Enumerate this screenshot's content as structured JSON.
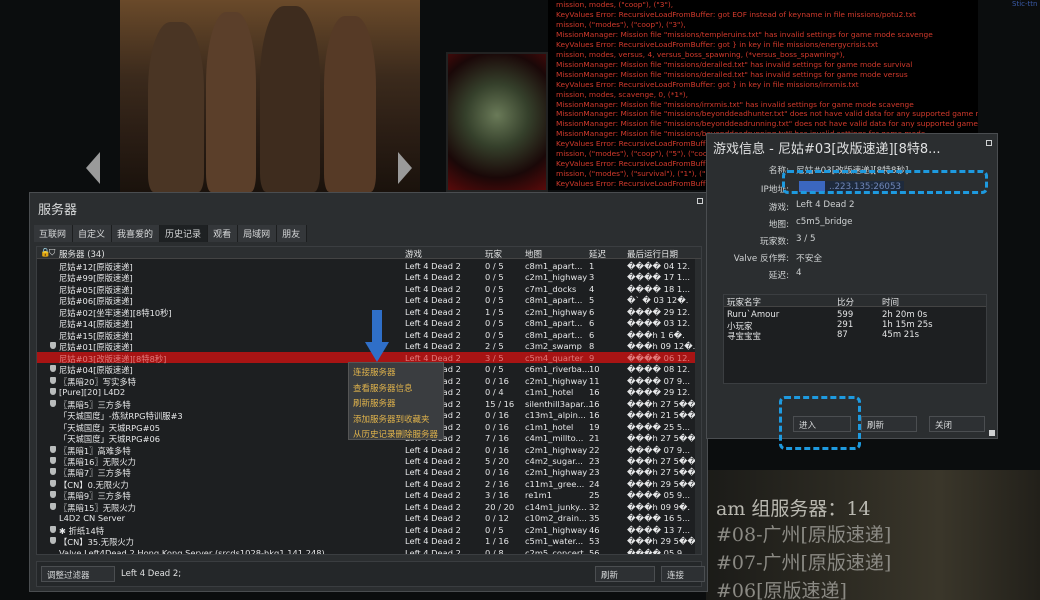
{
  "console": {
    "lines": [
      "mission, modes, (\"coop\"), (\"3\"),",
      "KeyValues Error: RecursiveLoadFromBuffer:  got EOF instead of keyname in file missions/potu2.txt",
      "mission, (\"modes\"), (\"coop\"), (\"3\"),",
      "MissionManager:  Mission file \"missions/templeruins.txt\" has invalid settings for game mode scavenge",
      "KeyValues Error: RecursiveLoadFromBuffer:  got } in key in file missions/energycrisis.txt",
      "mission, modes, versus, 4, versus_boss_spawning, (*versus_boss_spawning*),",
      "MissionManager:  Mission file \"missions/derailed.txt\" has invalid settings for game mode survival",
      "MissionManager:  Mission file \"missions/derailed.txt\" has invalid settings for game mode versus",
      "KeyValues Error: RecursiveLoadFromBuffer:  got } in key in file missions/irrxmis.txt",
      "mission, modes, scavenge, 0, (*1*),",
      "MissionManager:  Mission file \"missions/irrxmis.txt\" has invalid settings for game mode scavenge",
      "MissionManager:  Mission file \"missions/beyonddeadhunter.txt\" does not have valid data for any supported game mode",
      "MissionManager:  Mission file \"missions/beyonddeadrunning.txt\" does not have valid data for any supported game mode",
      "MissionManager:  Mission file \"missions/beyonddeadrunning.txt\" has invalid settings for game mode",
      "KeyValues Error: RecursiveLoadFromBuffer",
      "mission, (\"modes\"), (\"coop\"), (\"5\"), (\"coo",
      "KeyValues Error: RecursiveLoadFromBuffer",
      "mission, (\"modes\"), (\"survival\"), (\"1\"), (\"1",
      "KeyValues Error: RecursiveLoadFromBuffer"
    ]
  },
  "servers_window": {
    "title": "服务器",
    "tabs": [
      "互联网",
      "自定义",
      "我喜爱的",
      "历史记录",
      "观看",
      "局域网",
      "朋友"
    ],
    "active_tab": 3,
    "columns": [
      "服务器 (34)",
      "游戏",
      "玩家",
      "地图",
      "延迟",
      "最后运行日期"
    ],
    "rows": [
      {
        "name": "尼姑#12[原版速递]",
        "game": "Left 4 Dead 2",
        "players": "0 / 5",
        "map": "c8m1_apart...",
        "ping": "1",
        "date": "���� 04 12.",
        "shield": false
      },
      {
        "name": "尼姑#99[原版速递]",
        "game": "Left 4 Dead 2",
        "players": "0 / 5",
        "map": "c2m1_highway",
        "ping": "3",
        "date": "���� 17 1...",
        "shield": false
      },
      {
        "name": "尼姑#05[原版速递]",
        "game": "Left 4 Dead 2",
        "players": "0 / 5",
        "map": "c7m1_docks",
        "ping": "4",
        "date": "���� 18 1...",
        "shield": false
      },
      {
        "name": "尼姑#06[原版速递]",
        "game": "Left 4 Dead 2",
        "players": "0 / 5",
        "map": "c8m1_apart...",
        "ping": "5",
        "date": "�` � 03 12�.",
        "shield": false
      },
      {
        "name": "尼姑#02[坐牢速递][8特10秒]",
        "game": "Left 4 Dead 2",
        "players": "1 / 5",
        "map": "c2m1_highway",
        "ping": "6",
        "date": "���� 29 12.",
        "shield": false
      },
      {
        "name": "尼姑#14[原版速递]",
        "game": "Left 4 Dead 2",
        "players": "0 / 5",
        "map": "c8m1_apart...",
        "ping": "6",
        "date": "���� 03 12.",
        "shield": false
      },
      {
        "name": "尼姑#15[原版速递]",
        "game": "Left 4 Dead 2",
        "players": "0 / 5",
        "map": "c8m1_apart...",
        "ping": "6",
        "date": "���h 1 6�.",
        "shield": false
      },
      {
        "name": "尼姑#01[原版速递]",
        "game": "Left 4 Dead 2",
        "players": "2 / 5",
        "map": "c3m2_swamp",
        "ping": "8",
        "date": "���h 09 12�.",
        "shield": true
      },
      {
        "name": "尼姑#03[改版速递][8特8秒]",
        "game": "Left 4 Dead 2",
        "players": "3 / 5",
        "map": "c5m4_quarter",
        "ping": "9",
        "date": "���� 06 12.",
        "shield": false,
        "selected": true
      },
      {
        "name": "尼姑#04[原版速递]",
        "game": "Left 4 Dead 2",
        "players": "0 / 5",
        "map": "c6m1_riverba...",
        "ping": "10",
        "date": "���� 08 12.",
        "shield": true
      },
      {
        "name": "〖黑暗20〗写实多特",
        "game": "Left 4 Dead 2",
        "players": "0 / 16",
        "map": "c2m1_highway",
        "ping": "11",
        "date": "���� 07 9...",
        "shield": true
      },
      {
        "name": "[Pure][20] L4D2",
        "game": "Left 4 Dead 2",
        "players": "0 / 4",
        "map": "c1m1_hotel",
        "ping": "16",
        "date": "���� 29 12.",
        "shield": true
      },
      {
        "name": "〖黑暗5〗三方多特",
        "game": "Left 4 Dead 2",
        "players": "15 / 16",
        "map": "silenthill3apar...",
        "ping": "16",
        "date": "���h 27 5��.",
        "shield": true
      },
      {
        "name": "「天城国度」-炼狱RPG特训服#3",
        "game": "Left 4 Dead 2",
        "players": "0 / 16",
        "map": "c13m1_alpin...",
        "ping": "16",
        "date": "���h 21 5��.",
        "shield": false
      },
      {
        "name": "「天城国度」天城RPG#05",
        "game": "Left 4 Dead 2",
        "players": "0 / 16",
        "map": "c1m1_hotel",
        "ping": "19",
        "date": "���� 25 5...",
        "shield": false
      },
      {
        "name": "「天城国度」天城RPG#06",
        "game": "Left 4 Dead 2",
        "players": "7 / 16",
        "map": "c4m1_millto...",
        "ping": "21",
        "date": "���h 27 5��.",
        "shield": false
      },
      {
        "name": "〖黑暗1〗高难多特",
        "game": "Left 4 Dead 2",
        "players": "0 / 16",
        "map": "c2m1_highway",
        "ping": "22",
        "date": "���� 07 9...",
        "shield": true
      },
      {
        "name": "〖黑暗16〗无限火力",
        "game": "Left 4 Dead 2",
        "players": "5 / 20",
        "map": "c4m2_sugar...",
        "ping": "23",
        "date": "���h 27 5��.",
        "shield": true
      },
      {
        "name": "〖黑暗7〗三方多特",
        "game": "Left 4 Dead 2",
        "players": "0 / 16",
        "map": "c2m1_highway",
        "ping": "23",
        "date": "���h 27 5��.",
        "shield": true
      },
      {
        "name": "【CN】0.无限火力",
        "game": "Left 4 Dead 2",
        "players": "2 / 16",
        "map": "c11m1_gree...",
        "ping": "24",
        "date": "���h 29 5��.",
        "shield": true
      },
      {
        "name": "〖黑暗9〗三方多特",
        "game": "Left 4 Dead 2",
        "players": "3 / 16",
        "map": "re1m1",
        "ping": "25",
        "date": "���� 05 9...",
        "shield": true
      },
      {
        "name": "〖黑暗15〗无限火力",
        "game": "Left 4 Dead 2",
        "players": "20 / 20",
        "map": "c14m1_junky...",
        "ping": "32",
        "date": "���h 09 9�.",
        "shield": true
      },
      {
        "name": "L4D2 CN Server",
        "game": "Left 4 Dead 2",
        "players": "0 / 12",
        "map": "c10m2_drain...",
        "ping": "35",
        "date": "���� 16 5...",
        "shield": false
      },
      {
        "name": "✱ 折纸14特",
        "game": "Left 4 Dead 2",
        "players": "0 / 5",
        "map": "c2m1_highway",
        "ping": "46",
        "date": "���� 13 7...",
        "shield": true
      },
      {
        "name": "【CN】35.无限火力",
        "game": "Left 4 Dead 2",
        "players": "1 / 16",
        "map": "c5m1_water...",
        "ping": "53",
        "date": "���h 29 5��.",
        "shield": true
      },
      {
        "name": "Valve Left4Dead 2 Hong Kong Server (srcds1028-hkg1.141.248)",
        "game": "Left 4 Dead 2",
        "players": "0 / 8",
        "map": "c2m5_concert",
        "ping": "56",
        "date": "���� 05 9...",
        "shield": false
      }
    ],
    "filter_button": "调整过滤器",
    "filter_text": "Left 4 Dead 2;",
    "refresh_button": "刷新",
    "connect_button": "连接"
  },
  "context_menu": {
    "items": [
      "连接服务器",
      "查看服务器信息",
      "刷新服务器",
      "添加服务器到收藏夹",
      "从历史记录删除服务器"
    ]
  },
  "info_dialog": {
    "title": "游戏信息 - 尼姑#03[改版速递][8特8...",
    "fields": [
      {
        "key": "名称:",
        "value": "尼姑#03[改版速递][8特8秒]"
      },
      {
        "key": "IP地址:",
        "value": "..223.135:26053"
      },
      {
        "key": "游戏:",
        "value": "Left 4 Dead 2"
      },
      {
        "key": "地图:",
        "value": "c5m5_bridge"
      },
      {
        "key": "玩家数:",
        "value": "3 / 5"
      },
      {
        "key": "Valve 反作弊:",
        "value": "不安全"
      },
      {
        "key": "延迟:",
        "value": "4"
      }
    ],
    "player_columns": [
      "玩家名字",
      "比分",
      "时间"
    ],
    "players": [
      {
        "name": "Ruru`Amour",
        "score": "599",
        "time": "2h 20m 0s"
      },
      {
        "name": "小玩家",
        "score": "291",
        "time": "1h 15m 25s"
      },
      {
        "name": "寻宝宝宝",
        "score": "87",
        "time": "45m 21s"
      }
    ],
    "join_button": "进入",
    "refresh_button": "刷新",
    "close_button": "关闭"
  },
  "background": {
    "group_text": "am 组服务器：14",
    "lines": [
      "#08-广州[原版速递]",
      "#07-广州[原版速递]",
      "#06[原版速递]"
    ],
    "corner_label": "Stic-ttn"
  },
  "colors": {
    "console_text": "#d23a2c",
    "selected_row": "#a81414",
    "highlight_dash": "#1e9adf",
    "context_text": "#e0b34b"
  }
}
